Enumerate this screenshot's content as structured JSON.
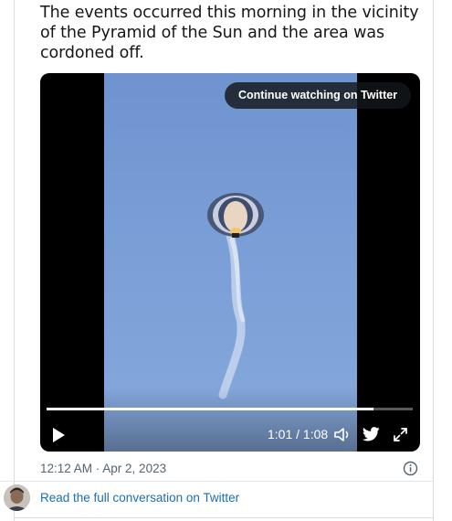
{
  "tweet": {
    "text": "The events occurred this morning in the vicinity of the Pyramid of the Sun and the area was cordoned off."
  },
  "video": {
    "continue_label": "Continue watching on Twitter",
    "time_display": "1:01 / 1:08",
    "progress": 0.893,
    "icons": {
      "play": "play-icon",
      "volume": "volume-icon",
      "twitter": "twitter-bird-icon",
      "fullscreen": "expand-icon"
    }
  },
  "meta": {
    "timestamp": "12:12 AM · Apr 2, 2023",
    "info_icon": "info-icon"
  },
  "footer": {
    "read_link": "Read the full conversation on Twitter"
  },
  "colors": {
    "link": "#1b6fb3",
    "muted": "#536471",
    "sky": "#7a9ed6"
  }
}
